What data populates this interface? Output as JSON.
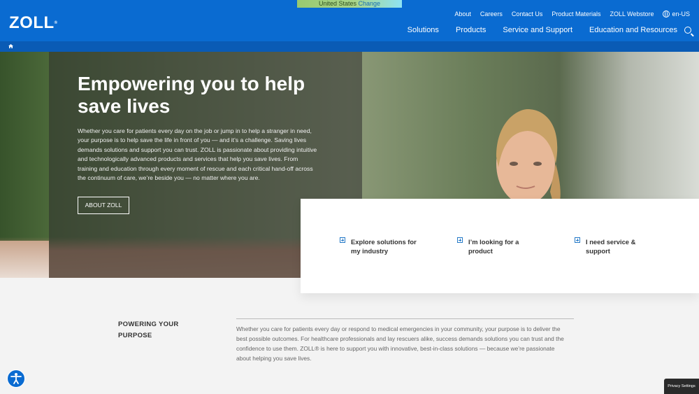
{
  "country": {
    "name": "United States",
    "change": "Change"
  },
  "brand": {
    "logo": "ZOLL",
    "registered": "®"
  },
  "utility_nav": [
    "About",
    "Careers",
    "Contact Us",
    "Product Materials",
    "ZOLL Webstore"
  ],
  "locale": "en-US",
  "main_nav": [
    "Solutions",
    "Products",
    "Service and Support",
    "Education and Resources"
  ],
  "hero": {
    "title": "Empowering you to help save lives",
    "text": "Whether you care for patients every day on the job or jump in to help a stranger in need, your purpose is to help save the life in front of you — and it’s a challenge. Saving lives demands solutions and support you can trust. ZOLL is passionate about providing intuitive and technologically advanced products and services that help you save lives. From training and education through every moment of rescue and each critical hand-off across the continuum of care, we’re beside you — no matter where you are.",
    "button": "ABOUT ZOLL"
  },
  "cta": [
    {
      "label": "Explore solutions for my industry"
    },
    {
      "label": "I’m looking for a product"
    },
    {
      "label": "I need service & support"
    }
  ],
  "purpose": {
    "heading": "POWERING YOUR PURPOSE",
    "text": "Whether you care for patients every day or respond to medical emergencies in your community, your purpose is to deliver the best possible outcomes. For healthcare professionals and lay rescuers alike, success demands solutions you can trust and the confidence to use them. ZOLL® is here to support you with innovative, best-in-class solutions — because we’re passionate about helping you save lives."
  },
  "privacy": "Privacy Settings",
  "colors": {
    "header": "#0a6bd1",
    "breadcrumb": "#0a5bb5",
    "accent": "#2479c7"
  }
}
